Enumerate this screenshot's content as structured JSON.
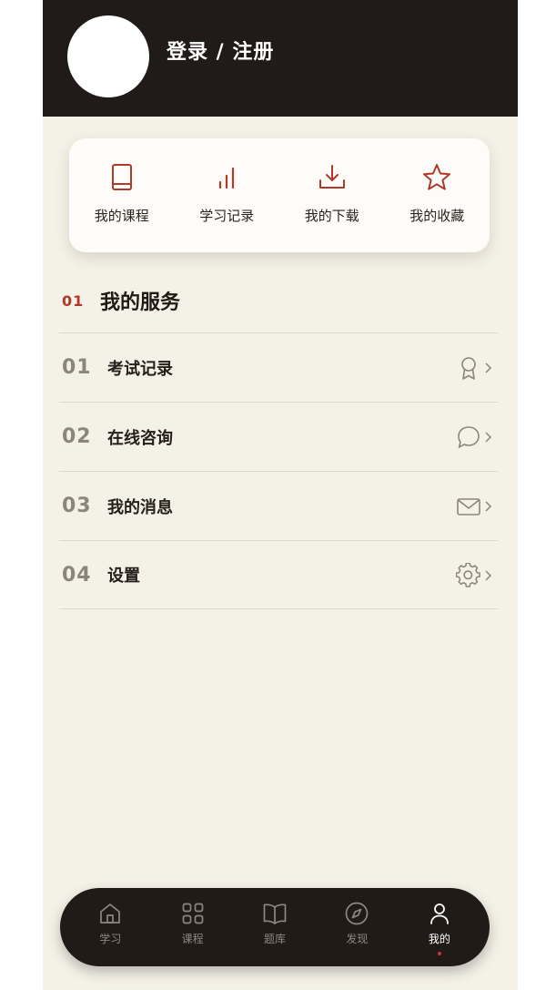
{
  "header": {
    "login_text": "登录 / 注册"
  },
  "quick_actions": [
    {
      "label": "我的课程",
      "icon": "book-icon"
    },
    {
      "label": "学习记录",
      "icon": "bar-chart-icon"
    },
    {
      "label": "我的下载",
      "icon": "download-icon"
    },
    {
      "label": "我的收藏",
      "icon": "star-icon"
    }
  ],
  "section": {
    "number": "01",
    "title": "我的服务"
  },
  "services": [
    {
      "number": "01",
      "label": "考试记录",
      "icon": "badge-icon"
    },
    {
      "number": "02",
      "label": "在线咨询",
      "icon": "chat-bubble-icon"
    },
    {
      "number": "03",
      "label": "我的消息",
      "icon": "mail-icon"
    },
    {
      "number": "04",
      "label": "设置",
      "icon": "gear-icon"
    }
  ],
  "tabbar": [
    {
      "label": "学习",
      "icon": "home-icon",
      "active": false
    },
    {
      "label": "课程",
      "icon": "grid-icon",
      "active": false
    },
    {
      "label": "题库",
      "icon": "open-book-icon",
      "active": false
    },
    {
      "label": "发现",
      "icon": "compass-icon",
      "active": false
    },
    {
      "label": "我的",
      "icon": "user-icon",
      "active": true
    }
  ],
  "colors": {
    "header_bg": "#201b18",
    "page_bg": "#f4f1e6",
    "accent": "#b0392a",
    "tabbar_bg": "#211b18"
  }
}
